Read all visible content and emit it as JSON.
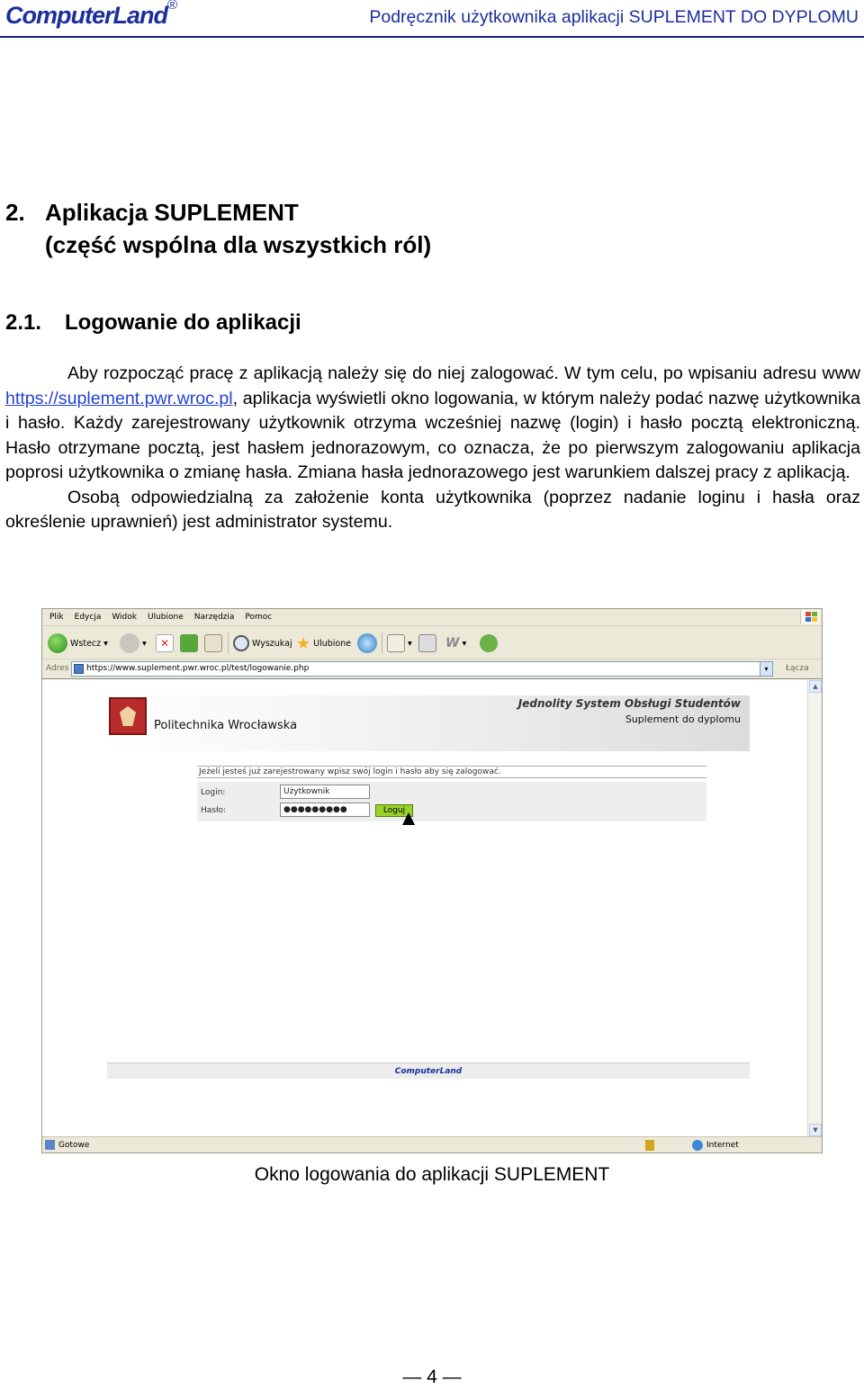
{
  "header": {
    "brand": "ComputerLand",
    "brand_mark": "®",
    "title": "Podręcznik użytkownika aplikacji SUPLEMENT DO DYPLOMU"
  },
  "section": {
    "number": "2.",
    "title_line1": "Aplikacja SUPLEMENT",
    "title_line2": "(część wspólna dla wszystkich ról)"
  },
  "subsection": {
    "number": "2.1.",
    "title": "Logowanie do aplikacji"
  },
  "paragraph1": {
    "before_link": "Aby rozpocząć pracę z aplikacją należy się do niej zalogować. W tym celu, po wpisaniu adresu www ",
    "link": "https://suplement.pwr.wroc.pl",
    "after_link": ", aplikacja wyświetli okno logowania, w którym należy podać nazwę użytkownika i hasło. Każdy zarejestrowany użytkownik otrzyma wcześniej nazwę (login) i hasło pocztą elektroniczną. Hasło otrzymane pocztą, jest hasłem jednorazowym, co oznacza, że po pierwszym zalogowaniu aplikacja poprosi użytkownika o zmianę hasła. Zmiana hasła jednorazowego jest warunkiem dalszej pracy z aplikacją."
  },
  "paragraph2": "Osobą odpowiedzialną za założenie konta użytkownika (poprzez nadanie loginu i hasła oraz określenie uprawnień) jest administrator systemu.",
  "browser": {
    "menu": [
      "Plik",
      "Edycja",
      "Widok",
      "Ulubione",
      "Narzędzia",
      "Pomoc"
    ],
    "toolbar": {
      "back": "Wstecz",
      "search": "Wyszukaj",
      "favorites": "Ulubione"
    },
    "address_label": "Adres",
    "address_value": "https://www.suplement.pwr.wroc.pl/test/logowanie.php",
    "go_label": "Łącza",
    "status_left": "Gotowe",
    "status_right": "Internet"
  },
  "site": {
    "university": "Politechnika Wrocławska",
    "system": "Jednolity System Obsługi Studentów",
    "module": "Suplement do dyplomu",
    "prompt": "Jeżeli jesteś już zarejestrowany wpisz swój login i hasło aby się zalogować.",
    "login_label": "Login:",
    "login_value": "Użytkownik",
    "password_label": "Hasło:",
    "password_value": "●●●●●●●●●",
    "login_button": "Loguj",
    "footer_brand": "ComputerLand"
  },
  "caption": "Okno logowania do aplikacji SUPLEMENT",
  "page_number": "— 4 —"
}
